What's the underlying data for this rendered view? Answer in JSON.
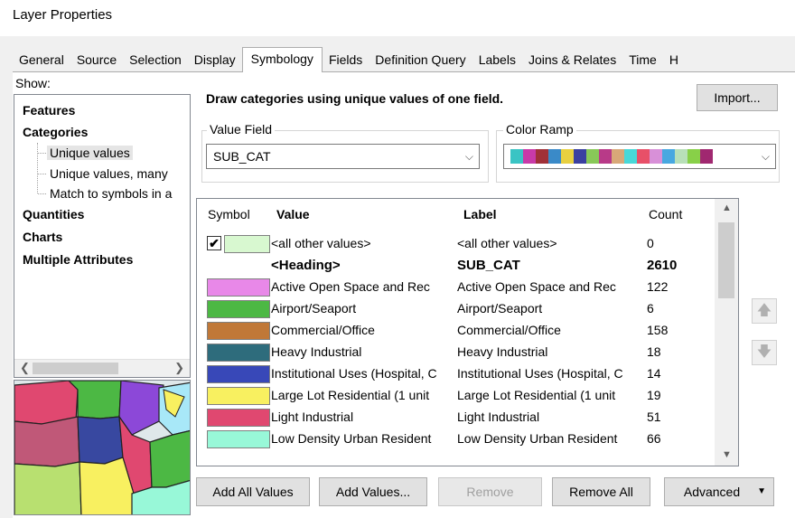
{
  "window": {
    "title": "Layer Properties"
  },
  "tabs": [
    {
      "label": "General"
    },
    {
      "label": "Source"
    },
    {
      "label": "Selection"
    },
    {
      "label": "Display"
    },
    {
      "label": "Symbology"
    },
    {
      "label": "Fields"
    },
    {
      "label": "Definition Query"
    },
    {
      "label": "Labels"
    },
    {
      "label": "Joins & Relates"
    },
    {
      "label": "Time"
    },
    {
      "label": "H"
    }
  ],
  "active_tab": "Symbology",
  "show": {
    "label": "Show:",
    "features": "Features",
    "categories": "Categories",
    "unique_values": "Unique values",
    "unique_values_many": "Unique values, many",
    "match_symbols": "Match to symbols in a",
    "quantities": "Quantities",
    "charts": "Charts",
    "multiple_attributes": "Multiple Attributes"
  },
  "main": {
    "heading": "Draw categories using unique values of one field.",
    "import_label": "Import...",
    "value_field_caption": "Value Field",
    "value_field_value": "SUB_CAT",
    "color_ramp_caption": "Color Ramp",
    "color_ramp_colors": [
      "#3ac4c4",
      "#c83aa8",
      "#a03038",
      "#3a8ac8",
      "#e8d040",
      "#3a40a0",
      "#88c858",
      "#b83a88",
      "#d8a878",
      "#48d8d8",
      "#e85068",
      "#d890d8",
      "#48a8e0",
      "#b8e0b8",
      "#88d048",
      "#a02870"
    ]
  },
  "table": {
    "headers": {
      "symbol": "Symbol",
      "value": "Value",
      "label": "Label",
      "count": "Count"
    },
    "rows": [
      {
        "color": "#d8f8d0",
        "checked": true,
        "value": "<all other values>",
        "label": "<all other values>",
        "count": "0",
        "bold": false
      },
      {
        "color": "",
        "checked": false,
        "value": "<Heading>",
        "label": "SUB_CAT",
        "count": "2610",
        "bold": true
      },
      {
        "color": "#e888e8",
        "value": "Active Open Space and Rec",
        "label": "Active Open Space and Rec",
        "count": "122",
        "bold": false
      },
      {
        "color": "#4cb844",
        "value": "Airport/Seaport",
        "label": "Airport/Seaport",
        "count": "6",
        "bold": false
      },
      {
        "color": "#c07838",
        "value": "Commercial/Office",
        "label": "Commercial/Office",
        "count": "158",
        "bold": false
      },
      {
        "color": "#2e6c7c",
        "value": "Heavy Industrial",
        "label": "Heavy Industrial",
        "count": "18",
        "bold": false
      },
      {
        "color": "#3848b8",
        "value": "Institutional Uses (Hospital, C",
        "label": "Institutional Uses (Hospital, C",
        "count": "14",
        "bold": false
      },
      {
        "color": "#f8f060",
        "value": "Large Lot Residential (1 unit",
        "label": "Large Lot Residential (1 unit",
        "count": "19",
        "bold": false
      },
      {
        "color": "#e04870",
        "value": "Light Industrial",
        "label": "Light Industrial",
        "count": "51",
        "bold": false
      },
      {
        "color": "#98f8d8",
        "value": "Low Density Urban Resident",
        "label": "Low Density Urban Resident",
        "count": "66",
        "bold": false
      }
    ]
  },
  "buttons": {
    "add_all_values": "Add All Values",
    "add_values": "Add Values...",
    "remove": "Remove",
    "remove_all": "Remove All",
    "advanced": "Advanced"
  },
  "colors": {
    "panel_bg": "#f0f0f0",
    "border": "#adadad"
  },
  "icons": [
    "checkbox-icon",
    "dropdown-arrow-icon",
    "move-up-icon",
    "move-down-icon",
    "scroll-left-icon",
    "scroll-right-icon",
    "scroll-up-icon",
    "scroll-down-icon"
  ]
}
